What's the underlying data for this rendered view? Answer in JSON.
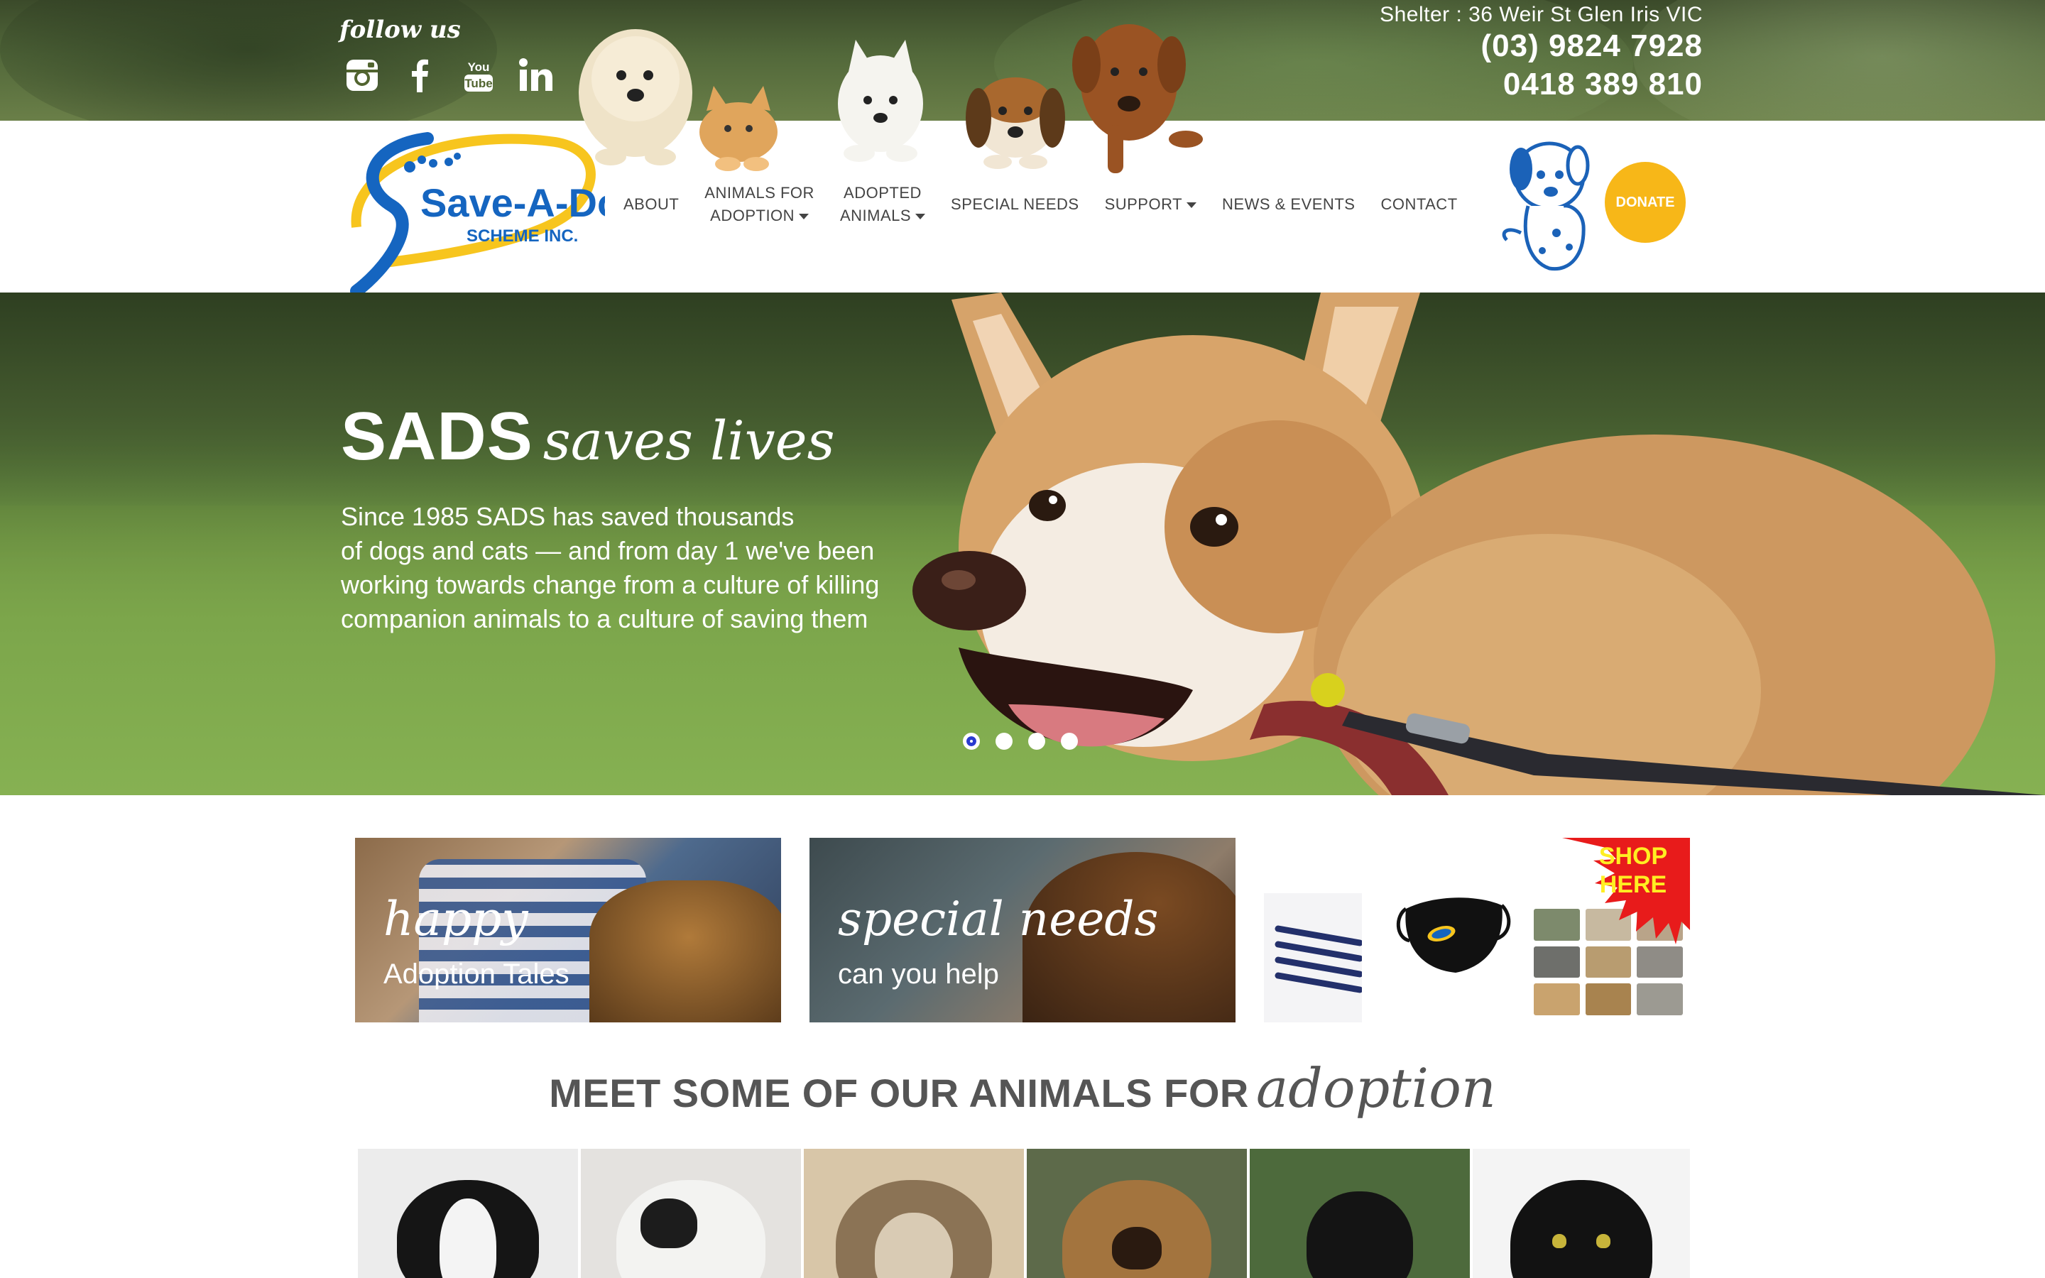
{
  "header": {
    "follow_label": "follow us",
    "social": [
      {
        "icon": "instagram-icon",
        "label": "Instagram"
      },
      {
        "icon": "facebook-icon",
        "label": "Facebook"
      },
      {
        "icon": "youtube-icon",
        "label": "YouTube"
      },
      {
        "icon": "linkedin-icon",
        "label": "LinkedIn"
      }
    ],
    "address": "Shelter : 36 Weir St Glen Iris VIC",
    "phone_1": "(03) 9824 7928",
    "phone_2": "0418 389 810",
    "logo": {
      "line1": "Save-A-Dog",
      "line2": "SCHEME INC."
    },
    "donate_label": "DONATE"
  },
  "nav": {
    "items": [
      {
        "line1": "ABOUT",
        "line2": "",
        "dropdown": false
      },
      {
        "line1": "ANIMALS FOR",
        "line2": "ADOPTION",
        "dropdown": true
      },
      {
        "line1": "ADOPTED",
        "line2": "ANIMALS",
        "dropdown": true
      },
      {
        "line1": "SPECIAL NEEDS",
        "line2": "",
        "dropdown": false
      },
      {
        "line1": "SUPPORT",
        "line2": "",
        "dropdown": true
      },
      {
        "line1": "NEWS & EVENTS",
        "line2": "",
        "dropdown": false
      },
      {
        "line1": "CONTACT",
        "line2": "",
        "dropdown": false
      }
    ]
  },
  "hero": {
    "title_bold": "SADS",
    "title_script": "saves lives",
    "text_lines": [
      "Since 1985 SADS has saved thousands",
      "of dogs and cats — and from day 1 we've been",
      "working towards change from a culture of killing",
      "companion animals to a culture of saving them"
    ],
    "slides_count": 4,
    "active_slide": 1
  },
  "tiles": [
    {
      "script": "happy",
      "sub": "Adoption Tales"
    },
    {
      "script": "special needs",
      "sub": "can you help"
    }
  ],
  "shop": {
    "line1": "SHOP",
    "line2": "HERE"
  },
  "meet": {
    "caps": "MEET SOME OF OUR ANIMALS FOR",
    "script": "adoption"
  },
  "colors": {
    "accent_yellow": "#f7b718",
    "logo_blue": "#1565c0",
    "text_gray": "#555555",
    "active_dot": "#2a3bd1"
  }
}
